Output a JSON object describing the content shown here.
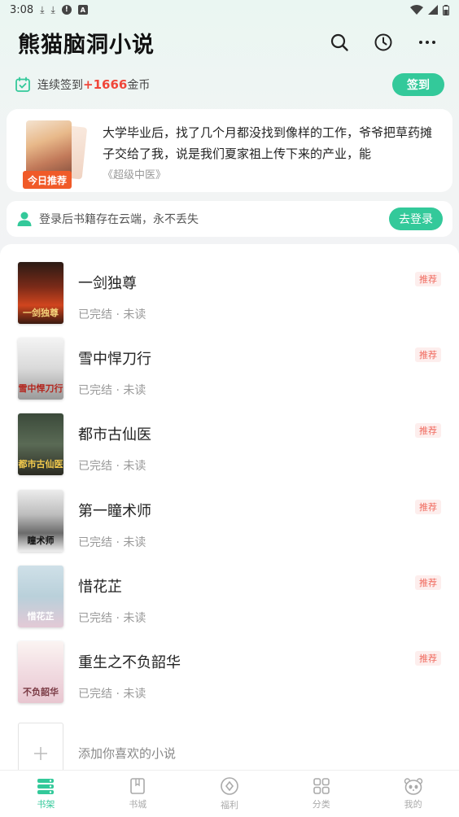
{
  "status_bar": {
    "time": "3:08"
  },
  "header": {
    "title": "熊猫脑洞小说"
  },
  "checkin": {
    "prefix": "连续签到",
    "bonus": "+1666",
    "suffix": "金币",
    "button": "签到"
  },
  "recommendation": {
    "badge": "今日推荐",
    "description": "大学毕业后，找了几个月都没找到像样的工作，爷爷把草药摊子交给了我，说是我们夏家祖上传下来的产业，能",
    "book": "《超级中医》"
  },
  "login_bar": {
    "text": "登录后书籍存在云端，永不丢失",
    "button": "去登录"
  },
  "books": [
    {
      "title": "一剑独尊",
      "status": "已完结 · 未读",
      "tag": "推荐",
      "cover_text": "一剑独尊"
    },
    {
      "title": "雪中悍刀行",
      "status": "已完结 · 未读",
      "tag": "推荐",
      "cover_text": "雪中悍刀行"
    },
    {
      "title": "都市古仙医",
      "status": "已完结 · 未读",
      "tag": "推荐",
      "cover_text": "都市古仙医"
    },
    {
      "title": "第一瞳术师",
      "status": "已完结 · 未读",
      "tag": "推荐",
      "cover_text": "瞳术师"
    },
    {
      "title": "惜花芷",
      "status": "已完结 · 未读",
      "tag": "推荐",
      "cover_text": "惜花芷"
    },
    {
      "title": "重生之不负韶华",
      "status": "已完结 · 未读",
      "tag": "推荐",
      "cover_text": "不负韶华"
    }
  ],
  "add_book": {
    "text": "添加你喜欢的小说"
  },
  "tabs": [
    {
      "label": "书架",
      "icon": "bookshelf-icon",
      "active": true
    },
    {
      "label": "书城",
      "icon": "bookstore-icon"
    },
    {
      "label": "福利",
      "icon": "welfare-icon"
    },
    {
      "label": "分类",
      "icon": "category-icon"
    },
    {
      "label": "我的",
      "icon": "panda-profile-icon"
    }
  ],
  "colors": {
    "accent": "#33c99a",
    "bonus": "#f0473a",
    "badge": "#f05a28",
    "tag_text": "#f06a5e",
    "tag_bg": "#fdeeed"
  }
}
